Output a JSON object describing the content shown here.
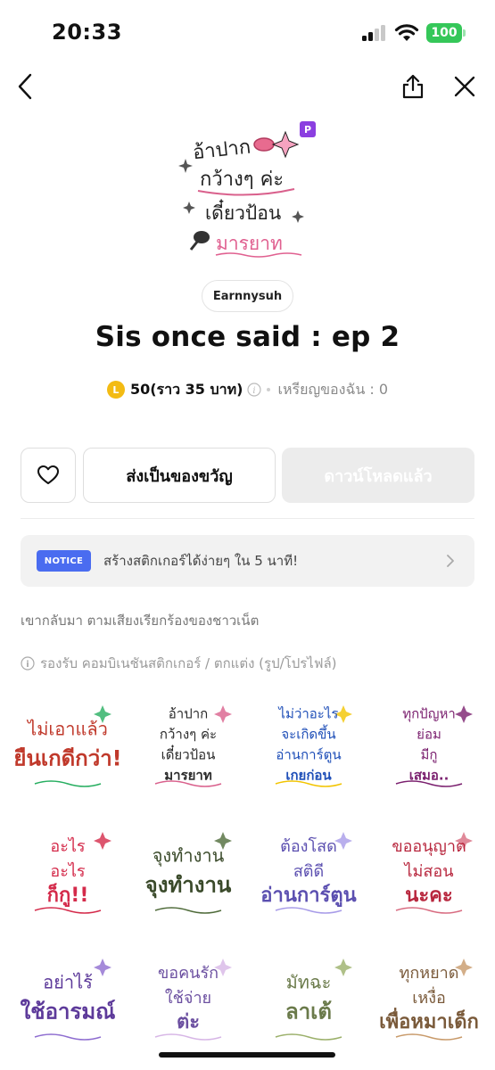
{
  "status_bar": {
    "time": "20:33",
    "battery": "100"
  },
  "product": {
    "author": "Earnnysuh",
    "title": "Sis once said : ep 2",
    "coin_symbol": "L",
    "price": "50(ราว 35 บาท)",
    "my_coins": "เหรียญของฉัน : 0",
    "premium_badge": "P"
  },
  "actions": {
    "gift_label": "ส่งเป็นของขวัญ",
    "download_label": "ดาวน์โหลดแล้ว"
  },
  "notice": {
    "badge": "NOTICE",
    "text": "สร้างสติกเกอร์ได้ง่ายๆ ใน 5 นาที!"
  },
  "description": "เขากลับมา ตามเสียงเรียกร้องของชาวเน็ต",
  "support": "รองรับ คอมบิเนชันสติกเกอร์ / ตกแต่ง (รูป/โปรไฟล์)",
  "colors": {
    "accent_blue": "#4a6cf0",
    "premium_purple": "#8b3fe0",
    "coin_yellow": "#f3bb13",
    "battery_green": "#35c759"
  },
  "stickers": [
    {
      "lines": [
        "ไม่เอาแล้ว",
        "ยืนเกดีกว่า!"
      ],
      "color": "#c0392b",
      "accent": "#27ae60"
    },
    {
      "lines": [
        "อ้าปาก",
        "กว้างๆ ค่ะ",
        "เดี๋ยวป้อน",
        "มารยาท"
      ],
      "color": "#2a2a2a",
      "accent": "#d9608c"
    },
    {
      "lines": [
        "ไม่ว่าอะไร",
        "จะเกิดขึ้น",
        "อ่านการ์ตูน",
        "เกยก่อน"
      ],
      "color": "#1f4fb8",
      "accent": "#f2c400"
    },
    {
      "lines": [
        "ทุกปัญหา",
        "ย่อม",
        "มีกู",
        "เสมอ.."
      ],
      "color": "#7a1f6e",
      "accent": "#7a1f6e"
    },
    {
      "lines": [
        "อะไร",
        "อะไร",
        "ก็กู!!"
      ],
      "color": "#d42a4a",
      "accent": "#d42a4a"
    },
    {
      "lines": [
        "จุงทำงาน",
        "จุงทำงาน"
      ],
      "color": "#3a4a2a",
      "accent": "#4f6b3a"
    },
    {
      "lines": [
        "ต้องโสด",
        "สติดี",
        "อ่านการ์ตูน"
      ],
      "color": "#5b4fb0",
      "accent": "#a79be8"
    },
    {
      "lines": [
        "ขออนุญาต",
        "ไม่สอน",
        "นะคะ"
      ],
      "color": "#b8273e",
      "accent": "#d86b80"
    },
    {
      "lines": [
        "อย่าไร้",
        "ใช้อารมณ์"
      ],
      "color": "#5d3a9a",
      "accent": "#8e6dd0"
    },
    {
      "lines": [
        "ขอคนรัก",
        "ใช้จ่าย",
        "ต่ะ"
      ],
      "color": "#6b4fa0",
      "accent": "#d7b6e6"
    },
    {
      "lines": [
        "มัทฉะ",
        "ลาเต้"
      ],
      "color": "#6a7a4a",
      "accent": "#9bb06a"
    },
    {
      "lines": [
        "ทุกหยาด",
        "เหงื่อ",
        "เพื่อหมาเด็ก"
      ],
      "color": "#7a5a3a",
      "accent": "#c89a6a"
    }
  ]
}
